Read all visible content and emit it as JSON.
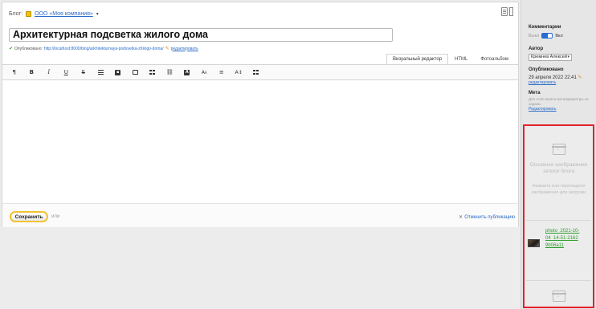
{
  "blog": {
    "label": "Блог:",
    "name": "ООО «Моя компания»",
    "caret": "▾"
  },
  "post": {
    "title": "Архитектурная подсветка жилого дома",
    "published_label": "Опубликовано:",
    "url": "http://localhost:8000/blog/arkhitekturnaya-podsvetka-zhilogo-doma/",
    "edit_label": "редактировать"
  },
  "mode_tabs": [
    {
      "label": "Визуальный редактор",
      "active": true
    },
    {
      "label": "HTML",
      "active": false
    },
    {
      "label": "Фотоальбом",
      "active": false
    }
  ],
  "toolbar": {
    "paragraph": "¶",
    "bold": "B",
    "italic": "I",
    "underline": "U",
    "strike": "S",
    "font_size": "A",
    "font_size_small": "A",
    "align": "≡",
    "text_size": "A↕"
  },
  "footer": {
    "save_label": "Сохранить",
    "cancel_label": "или",
    "unpublish_label": "Отменить публикацию",
    "unpublish_icon": "✕"
  },
  "sidebar": {
    "comments_heading": "Комментарии",
    "comments_off": "Выкл",
    "comments_on": "Вкл",
    "author_heading": "Автор",
    "author_value": "Кремнев Алексей",
    "published_heading": "Опубликовано",
    "published_date": "29 апреля 2022 22:41",
    "published_edit": "редактировать",
    "meta_heading": "Мета",
    "meta_text": "Для этой записи метапараметры не заданы.",
    "meta_edit": "Редактировать"
  },
  "image_panel": {
    "slot_title": "Основное изображение записи блога",
    "slot_hint": "Нажмите или перетащите изображения для загрузки",
    "file_name": "photo_2021-10-04_14-51-21629b06a11"
  },
  "colors": {
    "link": "#2a6bc8",
    "toggle_accent": "#2b6ad0",
    "save_border": "#f1c232",
    "highlight_border": "#e4212b",
    "file_link": "#2aa02a"
  }
}
